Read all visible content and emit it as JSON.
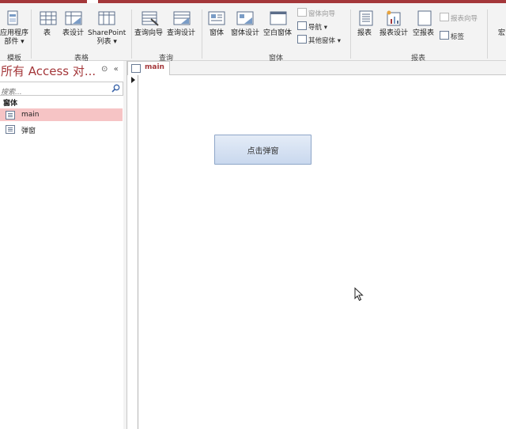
{
  "ribbon": {
    "templates": {
      "app_parts_line1": "应用程序",
      "app_parts_line2": "部件 ▾",
      "group_label": "模板"
    },
    "tables": {
      "table": "表",
      "table_design": "表设计",
      "sharepoint_line1": "SharePoint",
      "sharepoint_line2": "列表 ▾",
      "group_label": "表格"
    },
    "queries": {
      "query_wizard": "查询向导",
      "query_design": "查询设计",
      "group_label": "查询"
    },
    "forms": {
      "form": "窗体",
      "form_design": "窗体设计",
      "blank_form": "空白窗体",
      "form_wizard": "窗体向导",
      "navigation": "导航 ▾",
      "more_forms": "其他窗体 ▾",
      "group_label": "窗体"
    },
    "reports": {
      "report": "报表",
      "report_design": "报表设计",
      "blank_report": "空报表",
      "report_wizard": "报表向导",
      "labels": "标签",
      "group_label": "报表"
    },
    "macros": {
      "macro_partial": "宏"
    }
  },
  "nav_pane": {
    "title": "所有 Access 对...",
    "search_placeholder": "搜索...",
    "section_header": "窗体",
    "items": [
      {
        "label": "main",
        "selected": true
      },
      {
        "label": "弹窗",
        "selected": false
      }
    ]
  },
  "document": {
    "tab_label": "main",
    "popup_button_label": "点击弹窗"
  },
  "colors": {
    "accent": "#a4373a",
    "selection": "#f6c4c5",
    "ribbon_bg": "#f3f3f3"
  }
}
